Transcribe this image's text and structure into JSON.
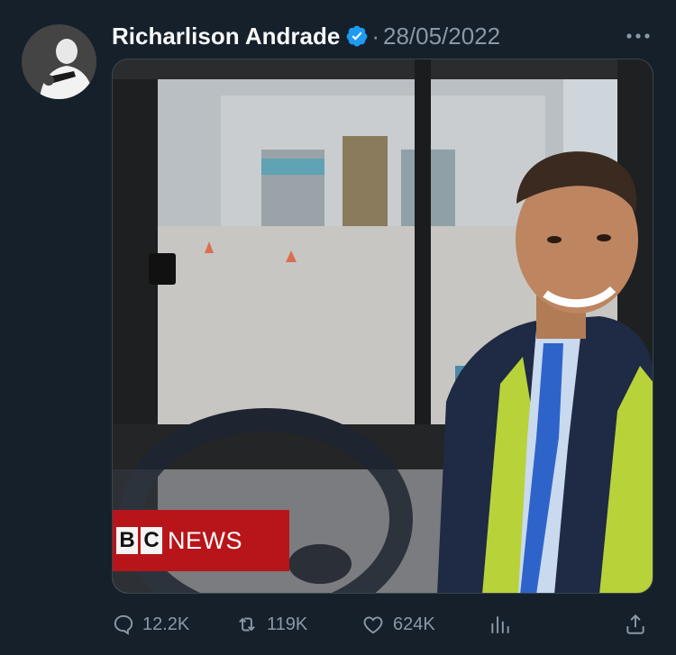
{
  "tweet": {
    "author_name": "Richarlison Andrade",
    "separator": "·",
    "date": "28/05/2022",
    "verified": true,
    "accent_color": "#1d9bf0",
    "muted_color": "#8b98a5",
    "background_color": "#15202b"
  },
  "media": {
    "overlay_logo_letters": "BC",
    "overlay_text": "NEWS",
    "overlay_color": "#b8151a"
  },
  "actions": {
    "replies": "12.2K",
    "retweets": "119K",
    "likes": "624K",
    "icons": [
      "reply-icon",
      "retweet-icon",
      "like-icon",
      "views-icon",
      "share-icon"
    ]
  }
}
